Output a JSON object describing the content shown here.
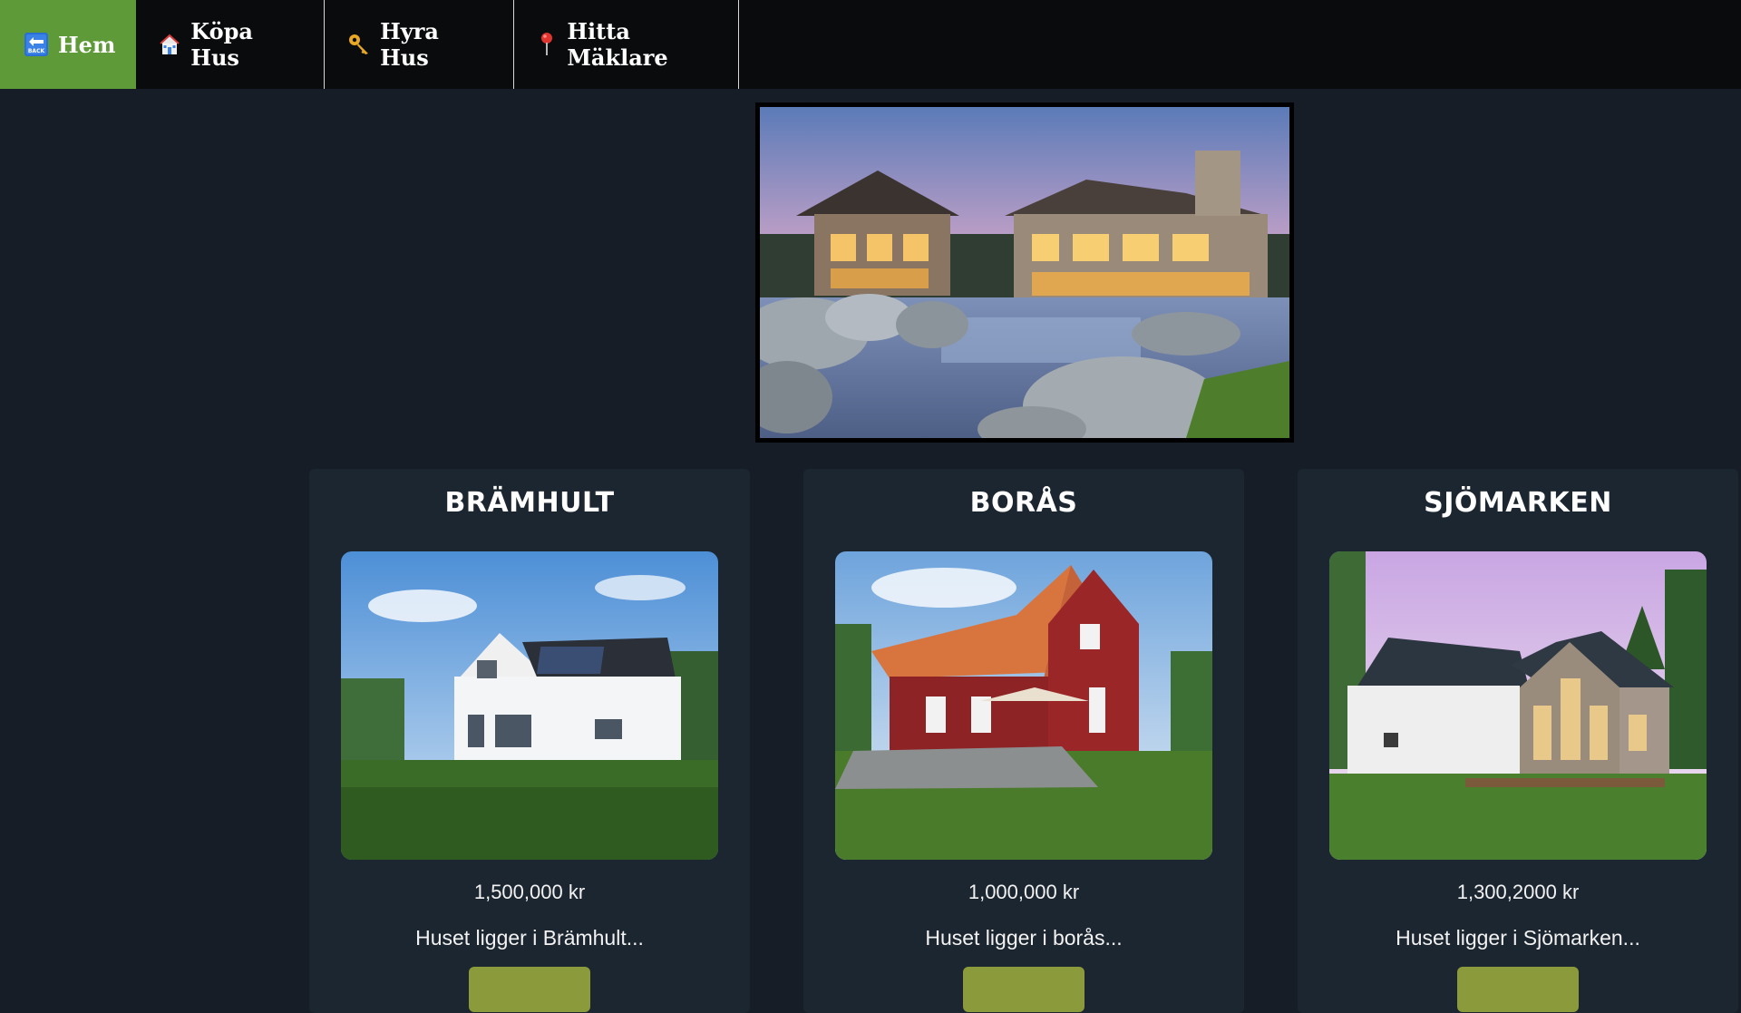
{
  "nav": {
    "items": [
      {
        "label": "Hem",
        "icon": "back-icon",
        "active": true
      },
      {
        "label": "Köpa Hus",
        "icon": "house-icon"
      },
      {
        "label": "Hyra Hus",
        "icon": "key-icon"
      },
      {
        "label": "Hitta Mäklare",
        "icon": "pin-icon"
      }
    ],
    "back_icon_text": "BACK",
    "active_color": "#5e9a37"
  },
  "hero": {
    "icon": "hero-villa-image"
  },
  "listings": [
    {
      "title": "BRÄMHULT",
      "price": "1,500,000 kr",
      "description": "Huset ligger i Brämhult..."
    },
    {
      "title": "BORÅS",
      "price": "1,000,000 kr",
      "description": "Huset ligger i borås..."
    },
    {
      "title": "SJÖMARKEN",
      "price": "1,300,2000 kr",
      "description": "Huset ligger i Sjömarken..."
    }
  ],
  "colors": {
    "background": "#161d26",
    "card": "#1c2630",
    "button": "#8b9a3a"
  }
}
